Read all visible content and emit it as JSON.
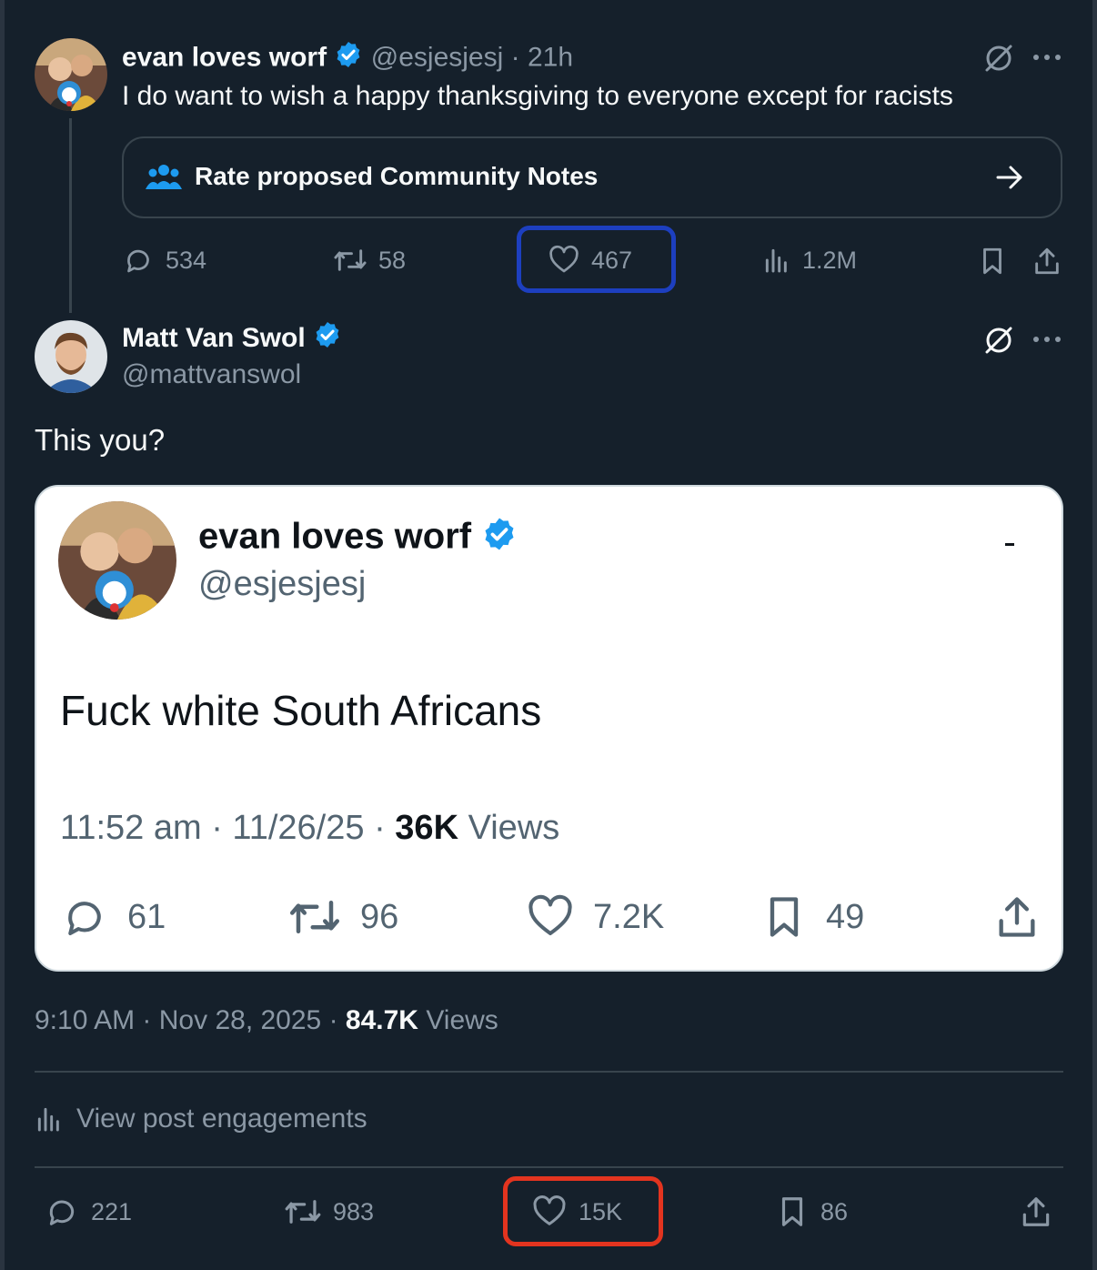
{
  "tweet1": {
    "author_name": "evan loves worf",
    "handle": "@esjesjesj",
    "separator": "·",
    "time": "21h",
    "text": "I do want to wish a happy thanksgiving to everyone except for racists",
    "community_notes_label": "Rate proposed Community Notes",
    "replies": "534",
    "reposts": "58",
    "likes": "467",
    "views": "1.2M"
  },
  "tweet2": {
    "author_name": "Matt Van Swol",
    "handle": "@mattvanswol",
    "text": "This you?",
    "time": "9:10 AM",
    "date": "Nov 28, 2025",
    "separator": "·",
    "views_count": "84.7K",
    "views_label": "Views",
    "engagements_label": "View post engagements",
    "replies": "221",
    "reposts": "983",
    "likes": "15K",
    "bookmarks": "86"
  },
  "embedded": {
    "author_name": "evan loves worf",
    "handle": "@esjesjesj",
    "text": "Fuck white South Africans",
    "time": "11:52 am",
    "date": "11/26/25",
    "separator": "·",
    "views_count": "36K",
    "views_label": "Views",
    "replies": "61",
    "reposts": "96",
    "likes": "7.2K",
    "bookmarks": "49"
  },
  "colors": {
    "background": "#15202b",
    "verified": "#1d9bf0",
    "highlight_blue": "#1d3fbf",
    "highlight_red": "#e3341f"
  },
  "icons": [
    "reply-icon",
    "repost-icon",
    "like-icon",
    "views-icon",
    "bookmark-icon",
    "share-icon",
    "grok-icon",
    "more-icon",
    "verified-badge-icon",
    "community-notes-icon",
    "arrow-right-icon"
  ]
}
